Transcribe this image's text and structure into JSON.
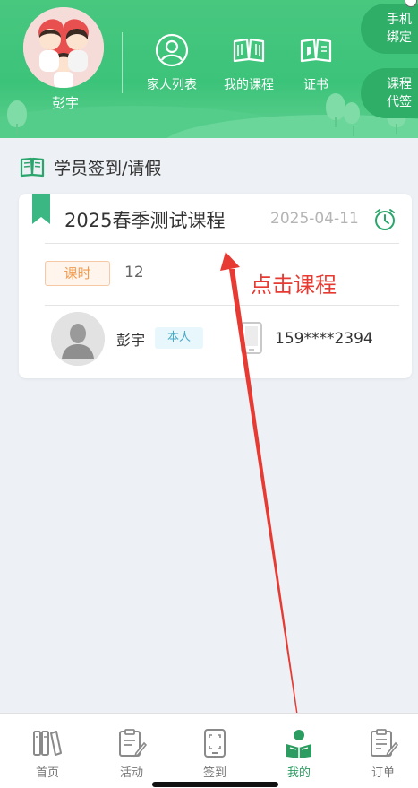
{
  "header": {
    "user_name": "彭宇",
    "nav": [
      {
        "label": "家人列表",
        "icon": "person-circle-icon"
      },
      {
        "label": "我的课程",
        "icon": "open-book-icon"
      },
      {
        "label": "证书",
        "icon": "book-icon"
      }
    ],
    "side_buttons": [
      {
        "line1": "手机",
        "line2": "绑定"
      },
      {
        "line1": "课程",
        "line2": "代签"
      }
    ]
  },
  "section": {
    "title": "学员签到/请假",
    "icon": "book-open-icon"
  },
  "course_card": {
    "title": "2025春季测试课程",
    "date": "2025-04-11",
    "hour_badge": "课时",
    "hour_count": "12",
    "person": {
      "name": "彭宇",
      "relation": "本人",
      "phone": "159****2394"
    }
  },
  "annotation": {
    "text": "点击课程",
    "color": "#e63a32"
  },
  "tabbar": {
    "tabs": [
      {
        "label": "首页",
        "icon": "books-icon",
        "active": false
      },
      {
        "label": "活动",
        "icon": "edit-note-icon",
        "active": false
      },
      {
        "label": "签到",
        "icon": "scan-device-icon",
        "active": false
      },
      {
        "label": "我的",
        "icon": "reading-person-icon",
        "active": true
      },
      {
        "label": "订单",
        "icon": "order-note-icon",
        "active": false
      }
    ]
  },
  "colors": {
    "brand_green": "#3cc37a",
    "accent_green": "#2c9c61",
    "badge_orange": "#f19a4e",
    "badge_blue": "#4aa9c7"
  }
}
